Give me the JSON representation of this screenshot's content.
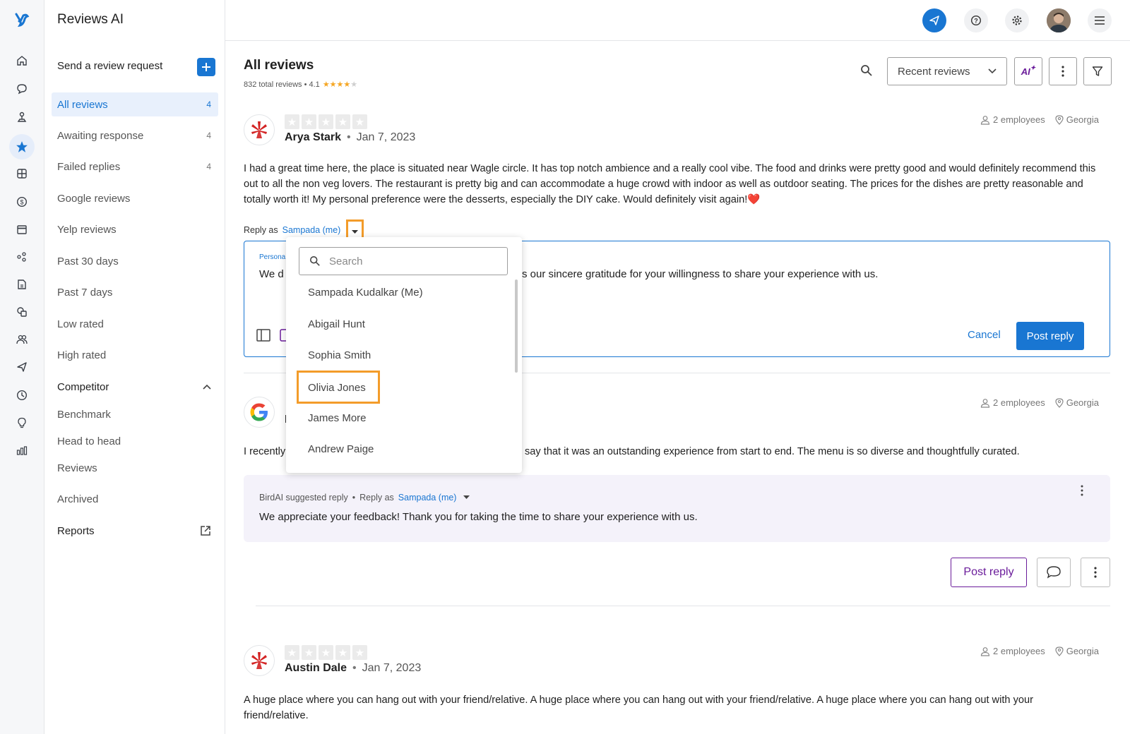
{
  "app": {
    "title": "Reviews AI"
  },
  "rail": {
    "icons": [
      "logo-icon",
      "home-icon",
      "chat-icon",
      "pin-icon",
      "star-icon",
      "grid-icon",
      "dollar-icon",
      "calendar-icon",
      "nodes-icon",
      "document-icon",
      "shapes-icon",
      "people-icon",
      "send-icon",
      "chart-clock-icon",
      "bulb-icon",
      "bars-icon"
    ]
  },
  "subnav": {
    "send_request_label": "Send a review request",
    "items": [
      {
        "label": "All reviews",
        "count": "4"
      },
      {
        "label": "Awaiting response",
        "count": "4"
      },
      {
        "label": "Failed replies",
        "count": "4"
      },
      {
        "label": "Google reviews"
      },
      {
        "label": "Yelp reviews"
      },
      {
        "label": "Past 30 days"
      },
      {
        "label": "Past 7 days"
      },
      {
        "label": "Low rated"
      },
      {
        "label": "High rated"
      }
    ],
    "competitor_label": "Competitor",
    "competitor_items": [
      "Benchmark",
      "Head to head",
      "Reviews"
    ],
    "archived_label": "Archived",
    "reports_label": "Reports"
  },
  "header": {
    "page_title": "All reviews",
    "summary": "832 total reviews • 4.1",
    "rating": 4.1,
    "sort_label": "Recent reviews",
    "ai_label": "AI"
  },
  "review1": {
    "author": "Arya Stark",
    "date": "Jan 7, 2023",
    "employees": "2 employees",
    "location": "Georgia",
    "text": "I had a great time here, the place is situated near Wagle circle. It has top notch ambience and a really cool vibe. The food and drinks were pretty good and would definitely recommend this out to all the non veg lovers. The restaurant is pretty big and can accommodate a huge crowd with indoor as well as outdoor seating. The prices for the dishes are pretty reasonable and totally worth it! My personal preference were the desserts, especially the DIY cake. Would definitely visit again!❤️",
    "reply_as_label": "Reply as",
    "reply_as_name": "Sampada (me)",
    "editor_label_partial": "Persona",
    "editor_text_start": "We d",
    "editor_text_end": "s our sincere gratitude for your willingness to share your experience with us.",
    "cancel_label": "Cancel",
    "post_label": "Post reply"
  },
  "dropdown": {
    "search_placeholder": "Search",
    "options": [
      "Sampada Kudalkar (Me)",
      "Abigail Hunt",
      "Sophia Smith",
      "Olivia Jones",
      "James More",
      "Andrew Paige"
    ],
    "highlighted": "Olivia Jones"
  },
  "review2": {
    "author_partial": "I",
    "employees": "2 employees",
    "location": "Georgia",
    "text_start": "I recently",
    "text_end": "say that it was an outstanding experience from start to end. The menu is so diverse and thoughtfully curated.",
    "suggest_label": "BirdAI suggested reply",
    "reply_as_label": "Reply as",
    "reply_as_name": "Sampada (me)",
    "suggested_text": "We appreciate your feedback! Thank you for taking the time to share your experience with us.",
    "post_label": "Post reply"
  },
  "review3": {
    "author": "Austin Dale",
    "date": "Jan 7, 2023",
    "employees": "2 employees",
    "location": "Georgia",
    "text": "A huge place where you can hang out with your friend/relative. A huge place where you can hang out with your friend/relative. A huge place where you can hang out with your friend/relative."
  },
  "colors": {
    "accent": "#1976d2",
    "highlight": "#f39c2a",
    "yelp": "#d32323",
    "purple": "#6a1b9a"
  }
}
